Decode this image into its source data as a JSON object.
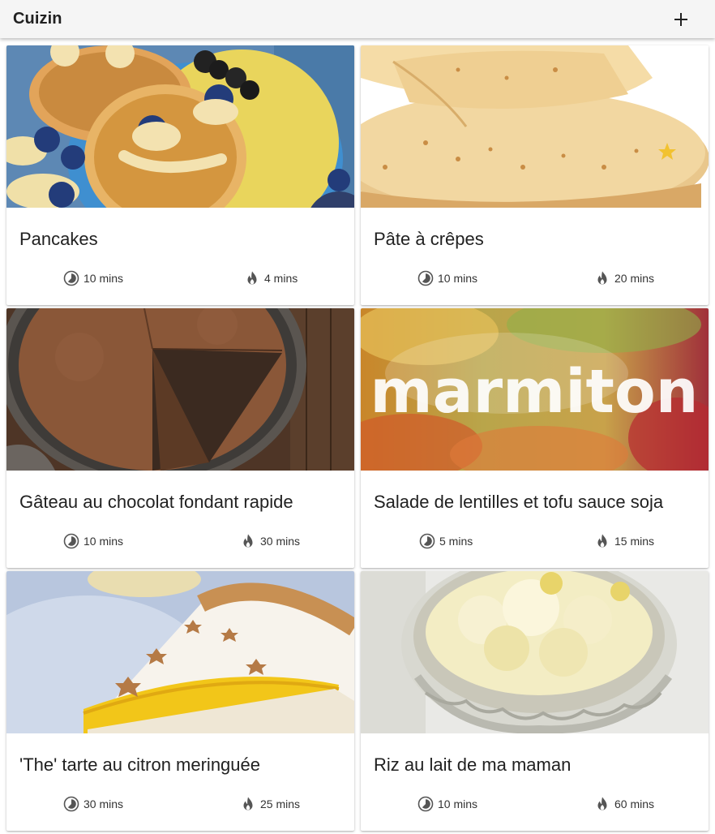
{
  "app": {
    "title": "Cuizin",
    "add_icon": "plus-icon"
  },
  "icons": {
    "prep": "timer-icon",
    "cook": "flame-icon"
  },
  "recipes": [
    {
      "title": "Pancakes",
      "prep": "10 mins",
      "cook": "4 mins",
      "image": "pancakes-photo"
    },
    {
      "title": "Pâte à crêpes",
      "prep": "10 mins",
      "cook": "20 mins",
      "image": "crepes-photo"
    },
    {
      "title": "Gâteau au chocolat fondant rapide",
      "prep": "10 mins",
      "cook": "30 mins",
      "image": "chocolate-cake-photo"
    },
    {
      "title": "Salade de lentilles et tofu sauce soja",
      "prep": "5 mins",
      "cook": "15 mins",
      "image": "marmiton-placeholder",
      "image_text": "marmiton"
    },
    {
      "title": "'The' tarte au citron meringuée",
      "prep": "30 mins",
      "cook": "25 mins",
      "image": "lemon-tart-photo"
    },
    {
      "title": "Riz au lait de ma maman",
      "prep": "10 mins",
      "cook": "60 mins",
      "image": "rice-pudding-photo"
    }
  ]
}
